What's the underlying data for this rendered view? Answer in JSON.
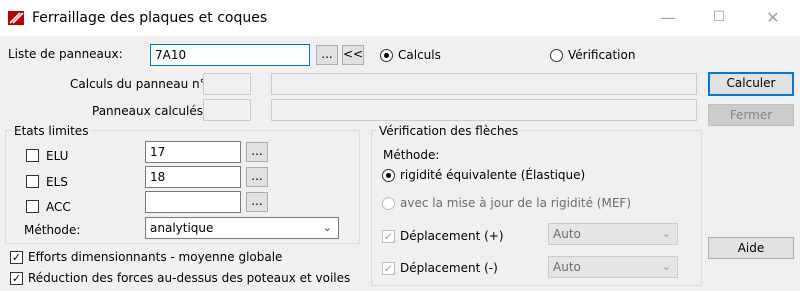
{
  "window": {
    "title": "Ferraillage des plaques et coques",
    "icon": "app-icon",
    "controls": [
      "minimize-icon",
      "maximize-icon",
      "close-icon"
    ]
  },
  "panels": {
    "label": "Liste de panneaux:",
    "value": "7A10",
    "browse_label": "...",
    "back_label": "<<",
    "mode_calculs": "Calculs",
    "mode_verification": "Vérification",
    "calc_panel_label": "Calculs du panneau n°:",
    "calculated_label": "Panneaux calculés:"
  },
  "buttons": {
    "calculer": "Calculer",
    "fermer": "Fermer",
    "aide": "Aide"
  },
  "limits": {
    "title": "Etats limites",
    "elu_label": "ELU",
    "elu_value": "17",
    "els_label": "ELS",
    "els_value": "18",
    "acc_label": "ACC",
    "acc_value": "",
    "browse_label": "...",
    "method_label": "Méthode:",
    "method_value": "analytique"
  },
  "efforts": {
    "label": "Efforts dimensionnants -  moyenne globale",
    "checked": true
  },
  "reduction": {
    "label": "Réduction des forces au-dessus des poteaux et voiles",
    "checked": true
  },
  "deflection": {
    "title": "Vérification des flèches",
    "method_label": "Méthode:",
    "option1": "rigidité équivalente (Élastique)",
    "option2": "avec la mise à jour de la rigidité (MEF)",
    "disp_plus_label": "Déplacement (+)",
    "disp_minus_label": "Déplacement (-)",
    "disp_plus_value": "Auto",
    "disp_minus_value": "Auto"
  },
  "colors": {
    "accent": "#0078d7",
    "window_bg": "#f0f0f0",
    "disabled_text": "#6d6d6d"
  }
}
